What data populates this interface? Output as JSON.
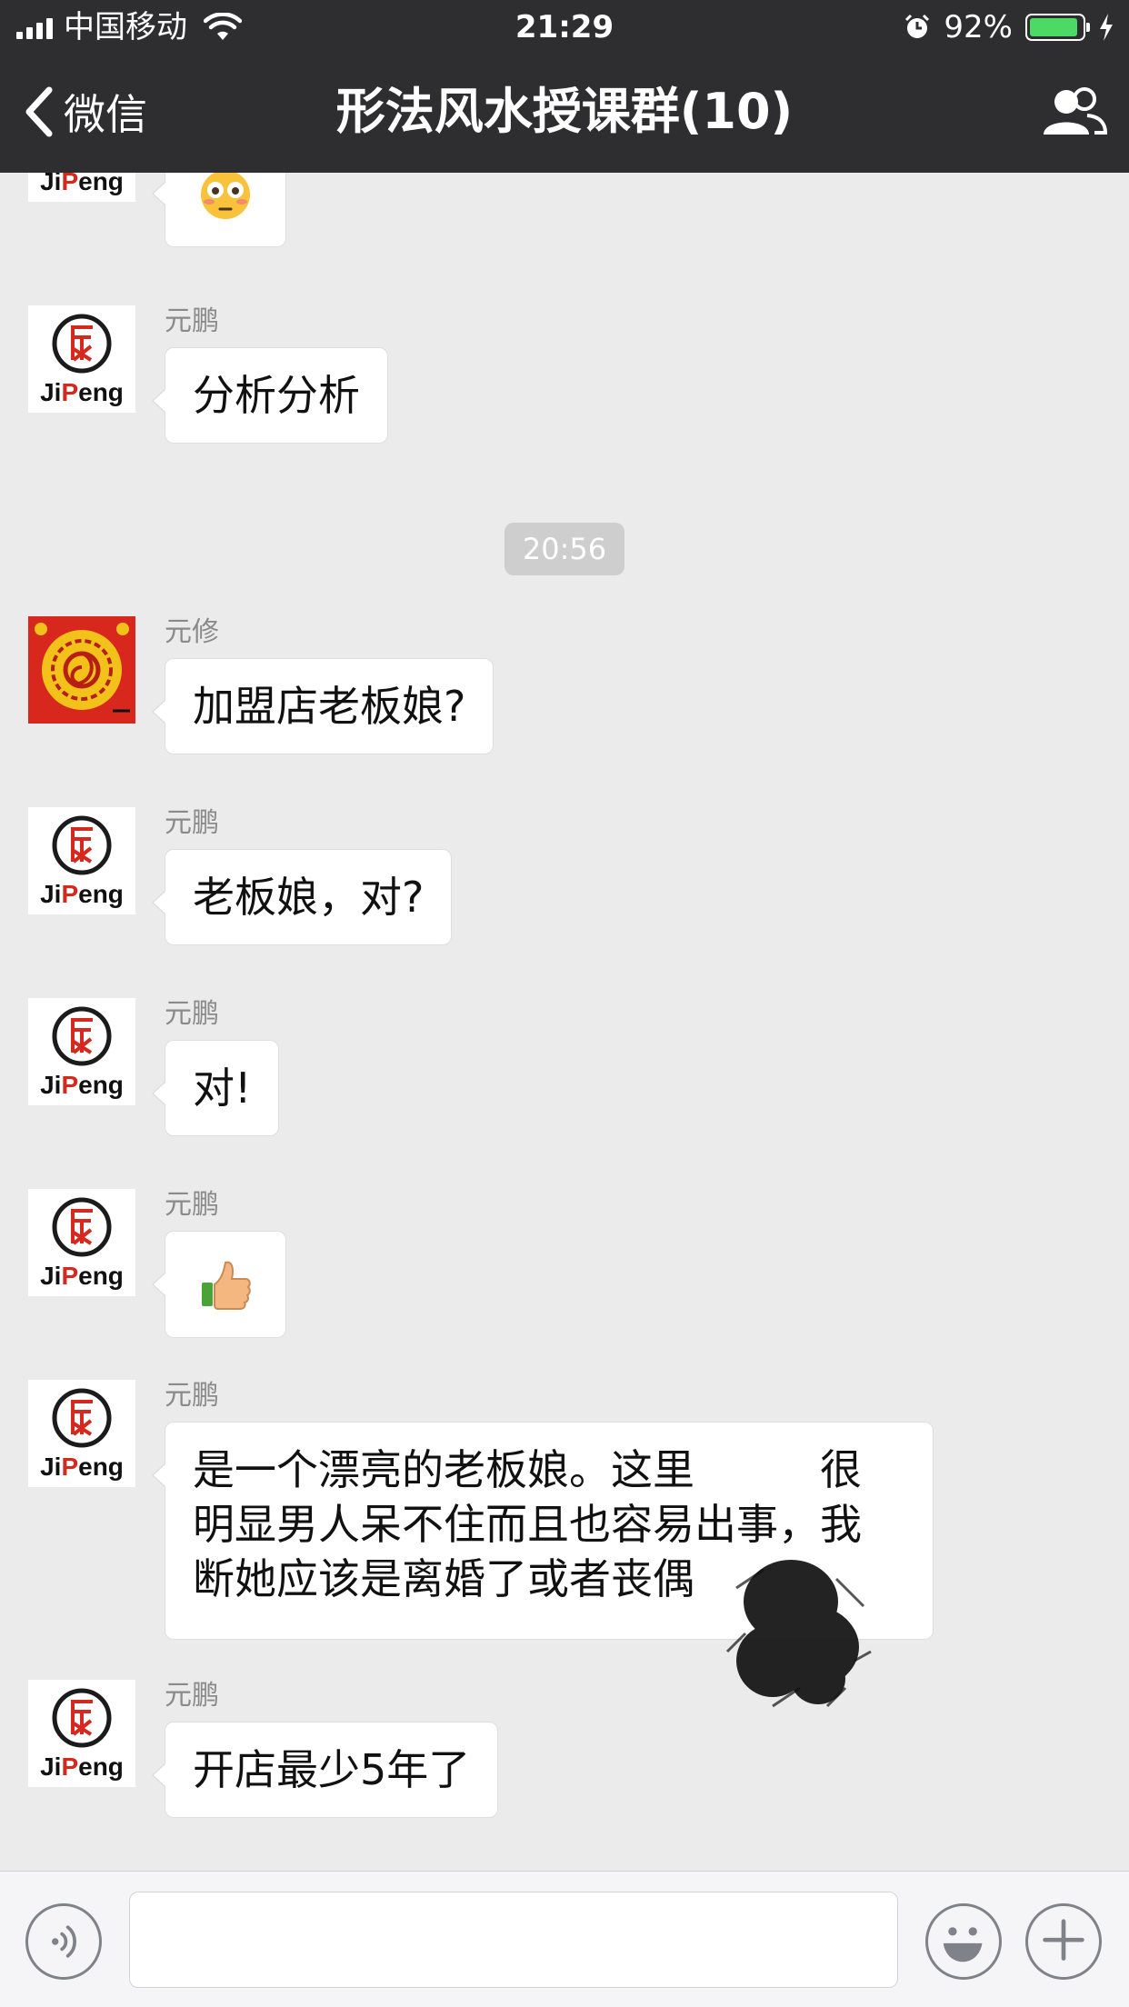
{
  "status_bar": {
    "carrier": "中国移动",
    "time": "21:29",
    "battery": "92%",
    "battery_level": 0.92
  },
  "nav": {
    "back_label": "微信",
    "title": "形法风水授课群(10)",
    "members_icon": "group-members-icon"
  },
  "chat": {
    "messages": [
      {
        "sender": "",
        "avatar": "jipeng-logo",
        "content_icon": "flushed-face-emoji"
      },
      {
        "sender": "元鹏",
        "avatar": "jipeng-logo",
        "text": "分析分析"
      },
      {
        "sender": "元修",
        "avatar": "red-yellow-dragon-emblem",
        "text": "加盟店老板娘?"
      },
      {
        "sender": "元鹏",
        "avatar": "jipeng-logo",
        "text": "老板娘，对?"
      },
      {
        "sender": "元鹏",
        "avatar": "jipeng-logo",
        "text": "对!"
      },
      {
        "sender": "元鹏",
        "avatar": "jipeng-logo",
        "content_icon": "thumbs-up-emoji"
      },
      {
        "sender": "元鹏",
        "avatar": "jipeng-logo",
        "lines": [
          "是一个漂亮的老板娘。这里",
          "很",
          "明显男人呆不住而且也容易出事，我",
          "断她应该是离婚了或者丧偶"
        ]
      },
      {
        "sender": "元鹏",
        "avatar": "jipeng-logo",
        "text": "开店最少5年了"
      }
    ],
    "timestamp": "20:56",
    "logo_text": {
      "ji": "Ji",
      "p": "P",
      "eng": "eng"
    }
  },
  "input_bar": {
    "voice_icon": "voice-input-icon",
    "text_value": "",
    "emoji_icon": "emoji-face-icon",
    "plus_icon": "plus-more-icon"
  },
  "colors": {
    "nav_bg": "#2e2e31",
    "chat_bg": "#ebebeb",
    "battery_green": "#4cd964",
    "logo_red": "#d5281e"
  }
}
